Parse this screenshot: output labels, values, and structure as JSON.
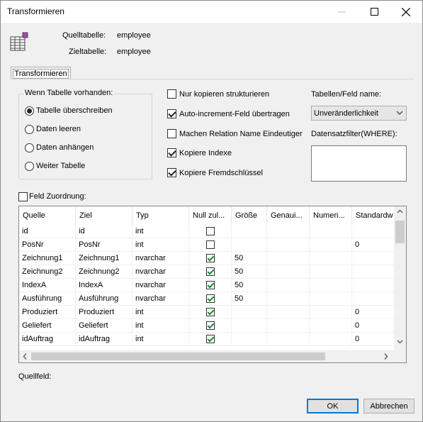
{
  "window": {
    "title": "Transformieren"
  },
  "header": {
    "source_label": "Quelltabelle:",
    "source_value": "employee",
    "target_label": "Zieltabelle:",
    "target_value": "employee"
  },
  "tab": {
    "label": "Transformieren"
  },
  "exists_group": {
    "legend": "Wenn Tabelle vorhanden:",
    "options": [
      "Tabelle überschreiben",
      "Daten leeren",
      "Daten anhängen",
      "Weiter Tabelle"
    ],
    "selected": "Tabelle überschreiben"
  },
  "options": [
    {
      "label": "Nur kopieren strukturieren",
      "checked": false
    },
    {
      "label": "Auto-increment-Feld übertragen",
      "checked": true
    },
    {
      "label": "Machen Relation Name Eindeutiger",
      "checked": false
    },
    {
      "label": "Kopiere Indexe",
      "checked": true
    },
    {
      "label": "Kopiere Fremdschlüssel",
      "checked": true
    }
  ],
  "naming": {
    "label": "Tabellen/Feld name:",
    "selected": "Unveränderlichkeit"
  },
  "filter": {
    "label": "Datensatzfilter(WHERE):",
    "value": ""
  },
  "field_mapping": {
    "label": "Feld Zuordnung:",
    "checked": false
  },
  "grid": {
    "columns": [
      "Quelle",
      "Ziel",
      "Typ",
      "Null zul...",
      "Größe",
      "Genaui...",
      "Numeri...",
      "Standardw"
    ],
    "rows": [
      {
        "source": "id",
        "target": "id",
        "type": "int",
        "nullable": false,
        "size": "",
        "precision": "",
        "numeric": "",
        "default": ""
      },
      {
        "source": "PosNr",
        "target": "PosNr",
        "type": "int",
        "nullable": false,
        "size": "",
        "precision": "",
        "numeric": "",
        "default": "0"
      },
      {
        "source": "Zeichnung1",
        "target": "Zeichnung1",
        "type": "nvarchar",
        "nullable": true,
        "size": "50",
        "precision": "",
        "numeric": "",
        "default": ""
      },
      {
        "source": "Zeichnung2",
        "target": "Zeichnung2",
        "type": "nvarchar",
        "nullable": true,
        "size": "50",
        "precision": "",
        "numeric": "",
        "default": ""
      },
      {
        "source": "IndexA",
        "target": "IndexA",
        "type": "nvarchar",
        "nullable": true,
        "size": "50",
        "precision": "",
        "numeric": "",
        "default": ""
      },
      {
        "source": "Ausführung",
        "target": "Ausführung",
        "type": "nvarchar",
        "nullable": true,
        "size": "50",
        "precision": "",
        "numeric": "",
        "default": ""
      },
      {
        "source": "Produziert",
        "target": "Produziert",
        "type": "int",
        "nullable": true,
        "size": "",
        "precision": "",
        "numeric": "",
        "default": "0"
      },
      {
        "source": "Geliefert",
        "target": "Geliefert",
        "type": "int",
        "nullable": true,
        "size": "",
        "precision": "",
        "numeric": "",
        "default": "0"
      },
      {
        "source": "idAuftrag",
        "target": "idAuftrag",
        "type": "int",
        "nullable": true,
        "size": "",
        "precision": "",
        "numeric": "",
        "default": "0"
      }
    ]
  },
  "source_field": {
    "label": "Quellfeld:"
  },
  "buttons": {
    "ok": "OK",
    "cancel": "Abbrechen"
  },
  "colors": {
    "accent": "#0078d7",
    "check_green": "#1e8a3a"
  }
}
